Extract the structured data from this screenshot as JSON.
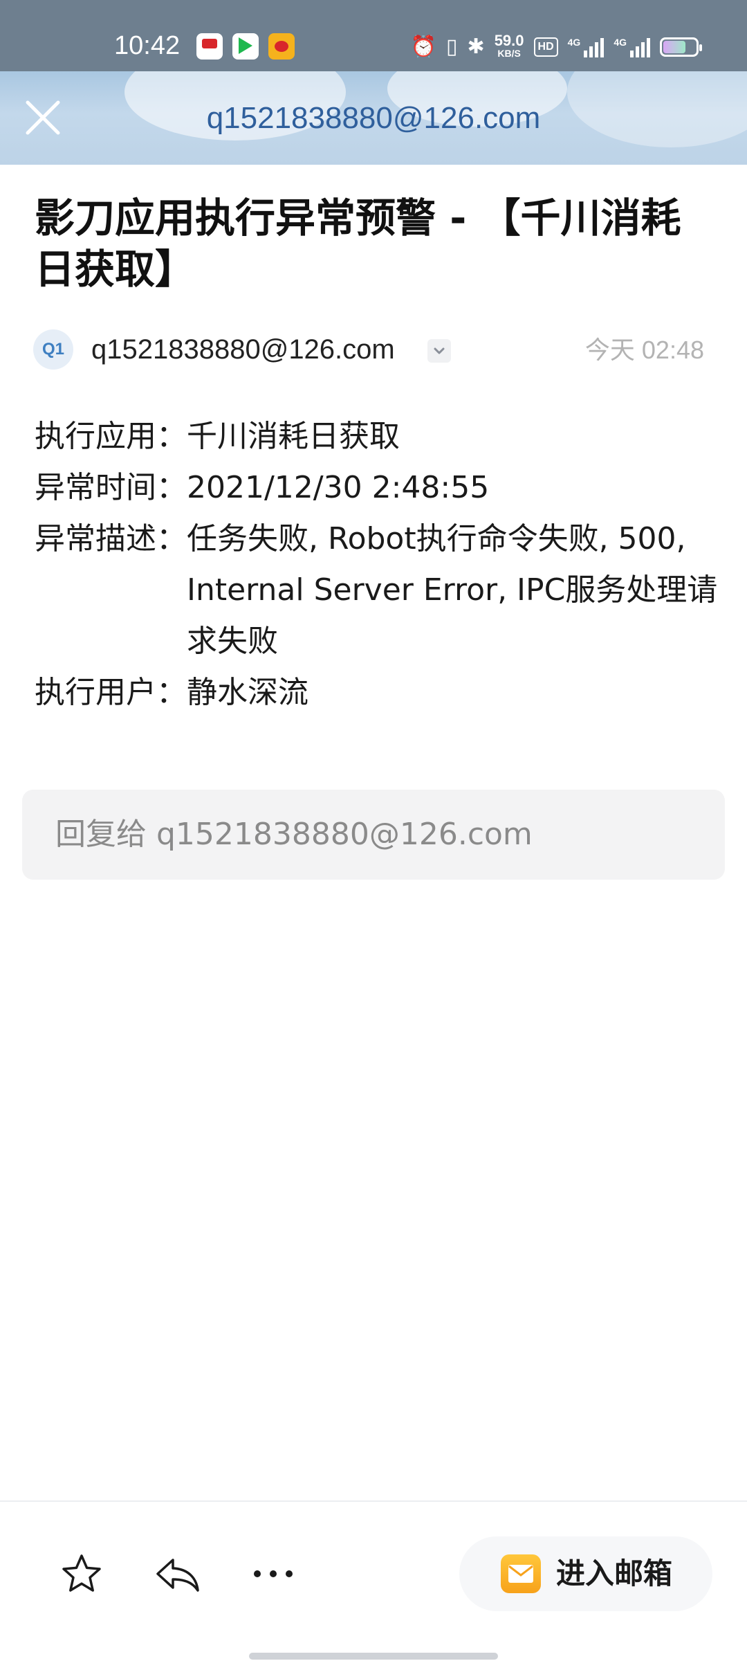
{
  "status_bar": {
    "time": "10:42",
    "net_speed_value": "59.0",
    "net_speed_unit": "KB/S",
    "hd_badge": "HD",
    "signal_1": "4G",
    "signal_2": "4G",
    "icons": [
      "alarm-icon",
      "vibrate-icon",
      "bluetooth-icon",
      "battery-icon"
    ]
  },
  "header": {
    "title": "q1521838880@126.com"
  },
  "email": {
    "subject": "影刀应用执行异常预警 - 【千川消耗日获取】",
    "sender_avatar": "Q1",
    "sender": "q1521838880@126.com",
    "time": "今天 02:48",
    "fields": [
      {
        "label": "执行应用：",
        "value": "千川消耗日获取"
      },
      {
        "label": "异常时间：",
        "value": "2021/12/30 2:48:55"
      },
      {
        "label": "异常描述：",
        "value": "任务失败, Robot执行命令失败, 500, Internal Server Error, IPC服务处理请求失败"
      },
      {
        "label": "执行用户：",
        "value": "静水深流"
      }
    ]
  },
  "reply": {
    "placeholder": "回复给 q1521838880@126.com"
  },
  "bottom_bar": {
    "enter_mailbox_label": "进入邮箱"
  },
  "colors": {
    "header_title": "#2f5f9c",
    "status_bar_bg": "#6e7f8f",
    "accent_mail_icon": "#f7a21b"
  }
}
